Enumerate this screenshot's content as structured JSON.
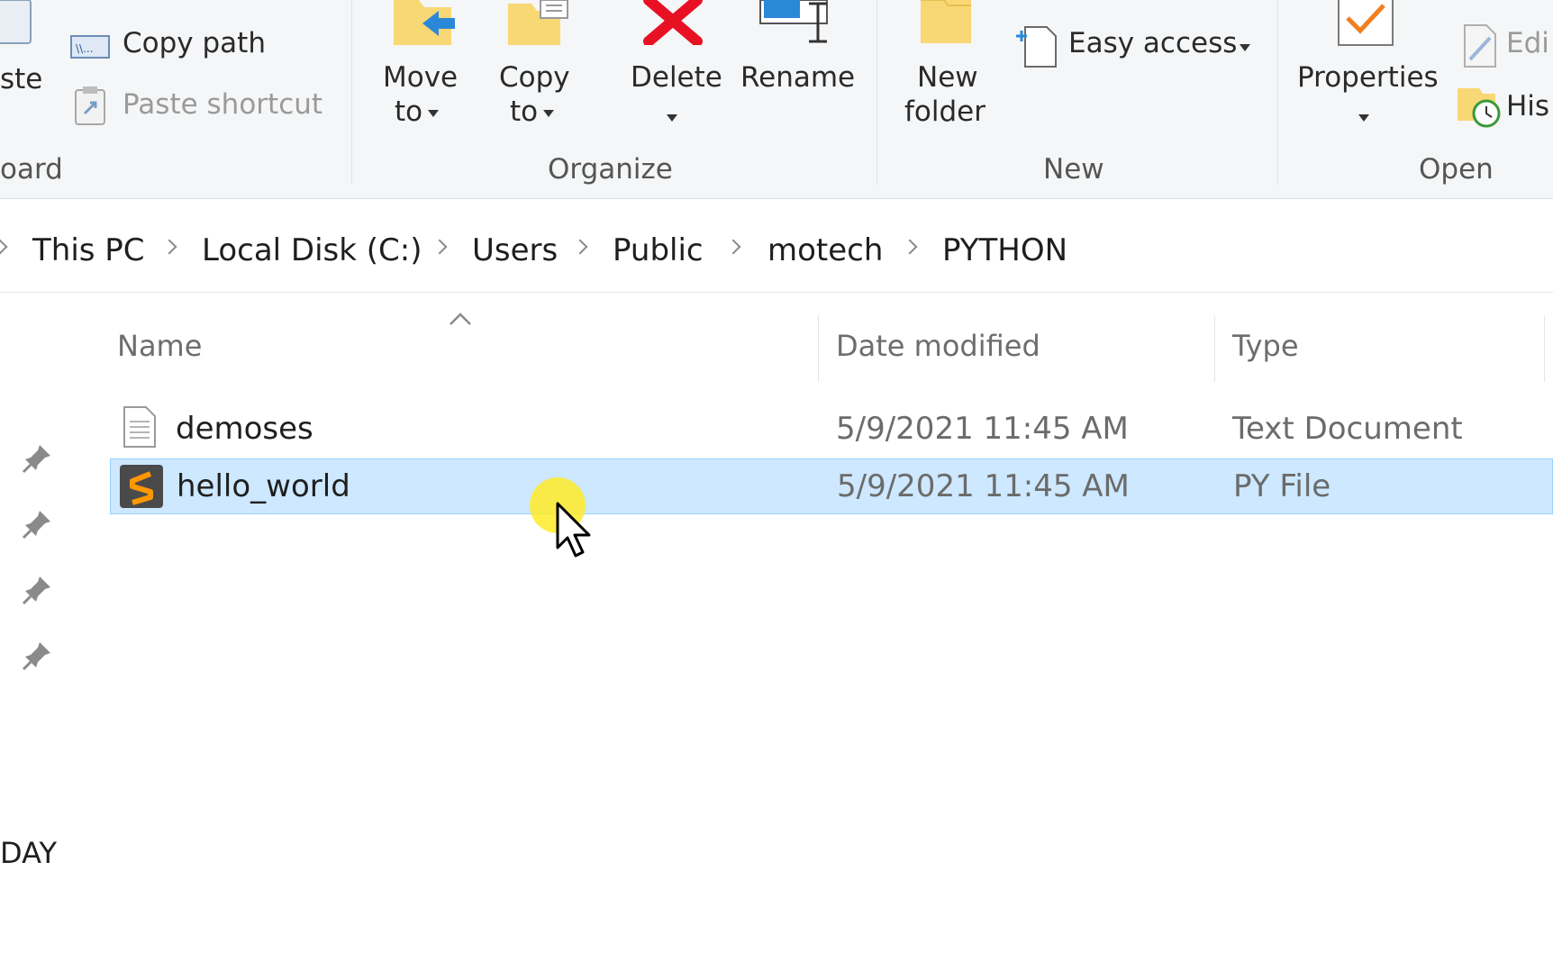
{
  "ribbon": {
    "clipboard": {
      "paste_partial": "ste",
      "copy_path": "Copy path",
      "paste_shortcut": "Paste shortcut",
      "group_partial": "oard"
    },
    "organize": {
      "move_to_line1": "Move",
      "move_to_line2": "to",
      "copy_to_line1": "Copy",
      "copy_to_line2": "to",
      "delete": "Delete",
      "rename": "Rename",
      "group": "Organize"
    },
    "new": {
      "new_folder_line1": "New",
      "new_folder_line2": "folder",
      "easy_access": "Easy access",
      "group": "New"
    },
    "open": {
      "properties": "Properties",
      "edit_partial": "Edi",
      "history_partial": "His",
      "group": "Open"
    }
  },
  "breadcrumb": [
    "This PC",
    "Local Disk (C:)",
    "Users",
    "Public",
    "motech",
    "PYTHON"
  ],
  "columns": {
    "name": "Name",
    "date_modified": "Date modified",
    "type": "Type"
  },
  "files": [
    {
      "name": "demoses",
      "date": "5/9/2021 11:45 AM",
      "type": "Text Document",
      "icon": "text-file-icon"
    },
    {
      "name": "hello_world",
      "date": "5/9/2021 11:45 AM",
      "type": "PY File",
      "icon": "sublime-file-icon",
      "selected": true
    }
  ],
  "nav_pane": {
    "partial_label": "DAY"
  },
  "colors": {
    "selection_bg": "#cde8ff",
    "selection_border": "#99d1ff",
    "delete_red": "#e81123",
    "folder_yellow": "#f8d775"
  }
}
